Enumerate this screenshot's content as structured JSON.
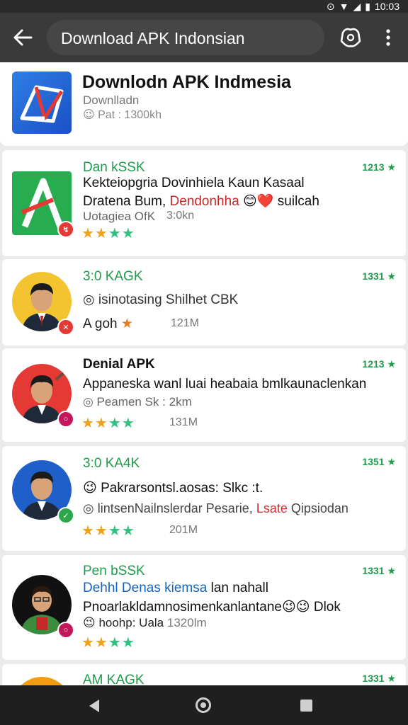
{
  "status_bar": {
    "time": "10:03"
  },
  "app_bar": {
    "title": "Download APK Indonsian"
  },
  "header": {
    "title": "Downlodn APK Indmesia",
    "subtitle": "Downlladn",
    "meta": "😉 Pat : 1300kh"
  },
  "items": [
    {
      "title": "Dan kSSK",
      "rank": "1213 ★",
      "line1": "Kekteiopgria Dovinhiela Kaun Kasaal",
      "line2a": "Dratena Bum, ",
      "line2b": "Dendonhha",
      "line2c": " 😊❤️ suilcah",
      "meta": "Uotagiea OfK",
      "size": "3:0kn",
      "rating": 2.5
    },
    {
      "title": "3:0 KAGK",
      "rank": "1331 ★",
      "line1": "◎ isinotasing Shilhet CBK",
      "meta": "A goh",
      "size": "121M",
      "rating": 1
    },
    {
      "title": "Denial APK",
      "rank": "1213 ★",
      "line1": "Appaneska wanl luai heabaia bmlkaunaclenkan",
      "meta": "◎ Peamen Sk :",
      "meta2": "2km",
      "size": "131M",
      "rating": 2.5
    },
    {
      "title": "3:0 KA4K",
      "rank": "1351 ★",
      "line1": "😉 Pakrarsontsl.aosas: Slkc :t.",
      "line2a": "◎ lintsenNailnslerdar Pesarie, ",
      "line2b": "Lsate",
      "line2c": " Qipsiodan",
      "size": "201M",
      "rating": 2.5
    },
    {
      "title": "Pen bSSK",
      "rank": "1331 ★",
      "line1a": "Dehhl Denas kiemsa",
      "line1b": " lan nahall",
      "line2": "Pnoarlakldamnosimenkanlantane😉😉 Dlok",
      "meta": "😉 hoohp: Uala",
      "size": "1320lm",
      "rating": 2.5
    },
    {
      "title": "AM KAGK",
      "rank": "1331 ★"
    }
  ],
  "colors": {
    "green": "#1f9b4b",
    "app_bar": "#3a3a3a",
    "link_blue": "#1565c0",
    "red": "#d32f2f"
  }
}
